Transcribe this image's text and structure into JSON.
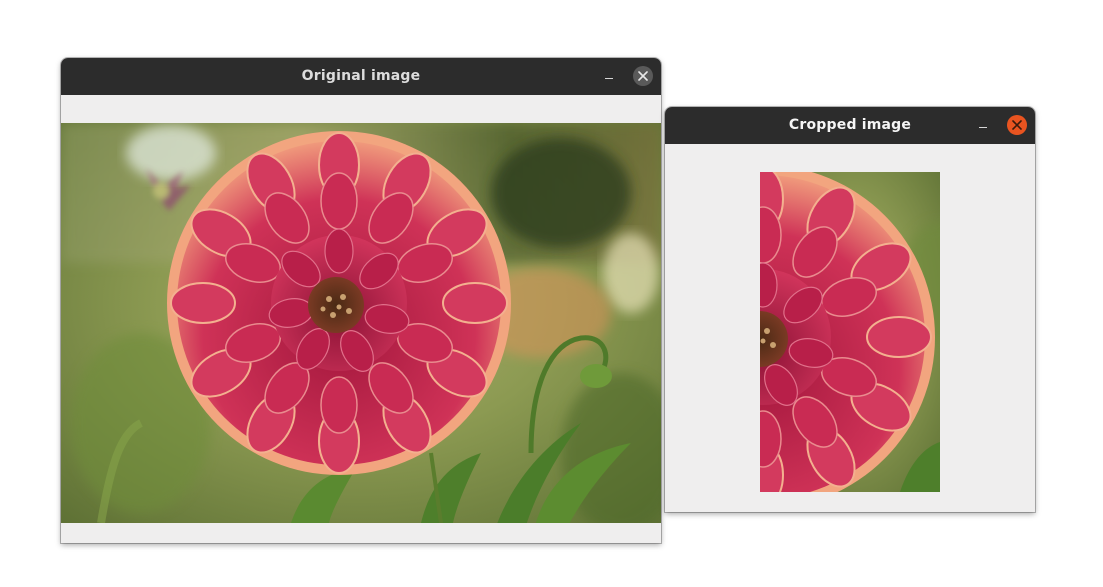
{
  "windows": {
    "original": {
      "title": "Original image",
      "buttons": {
        "minimize": "minimize-icon",
        "close": "close-icon"
      },
      "image": {
        "subject": "photo-dahlia-flower"
      }
    },
    "cropped": {
      "title": "Cropped image",
      "buttons": {
        "minimize": "minimize-icon",
        "close": "close-icon"
      },
      "image": {
        "subject": "photo-dahlia-flower-crop"
      },
      "close_accent": "#e95420"
    }
  },
  "theme": {
    "titlebar": "#2c2c2c",
    "window_bg": "#efeeee",
    "flower_petal": "#c2244d",
    "flower_tip": "#f2a27a",
    "foliage": "#6f8a3c"
  }
}
